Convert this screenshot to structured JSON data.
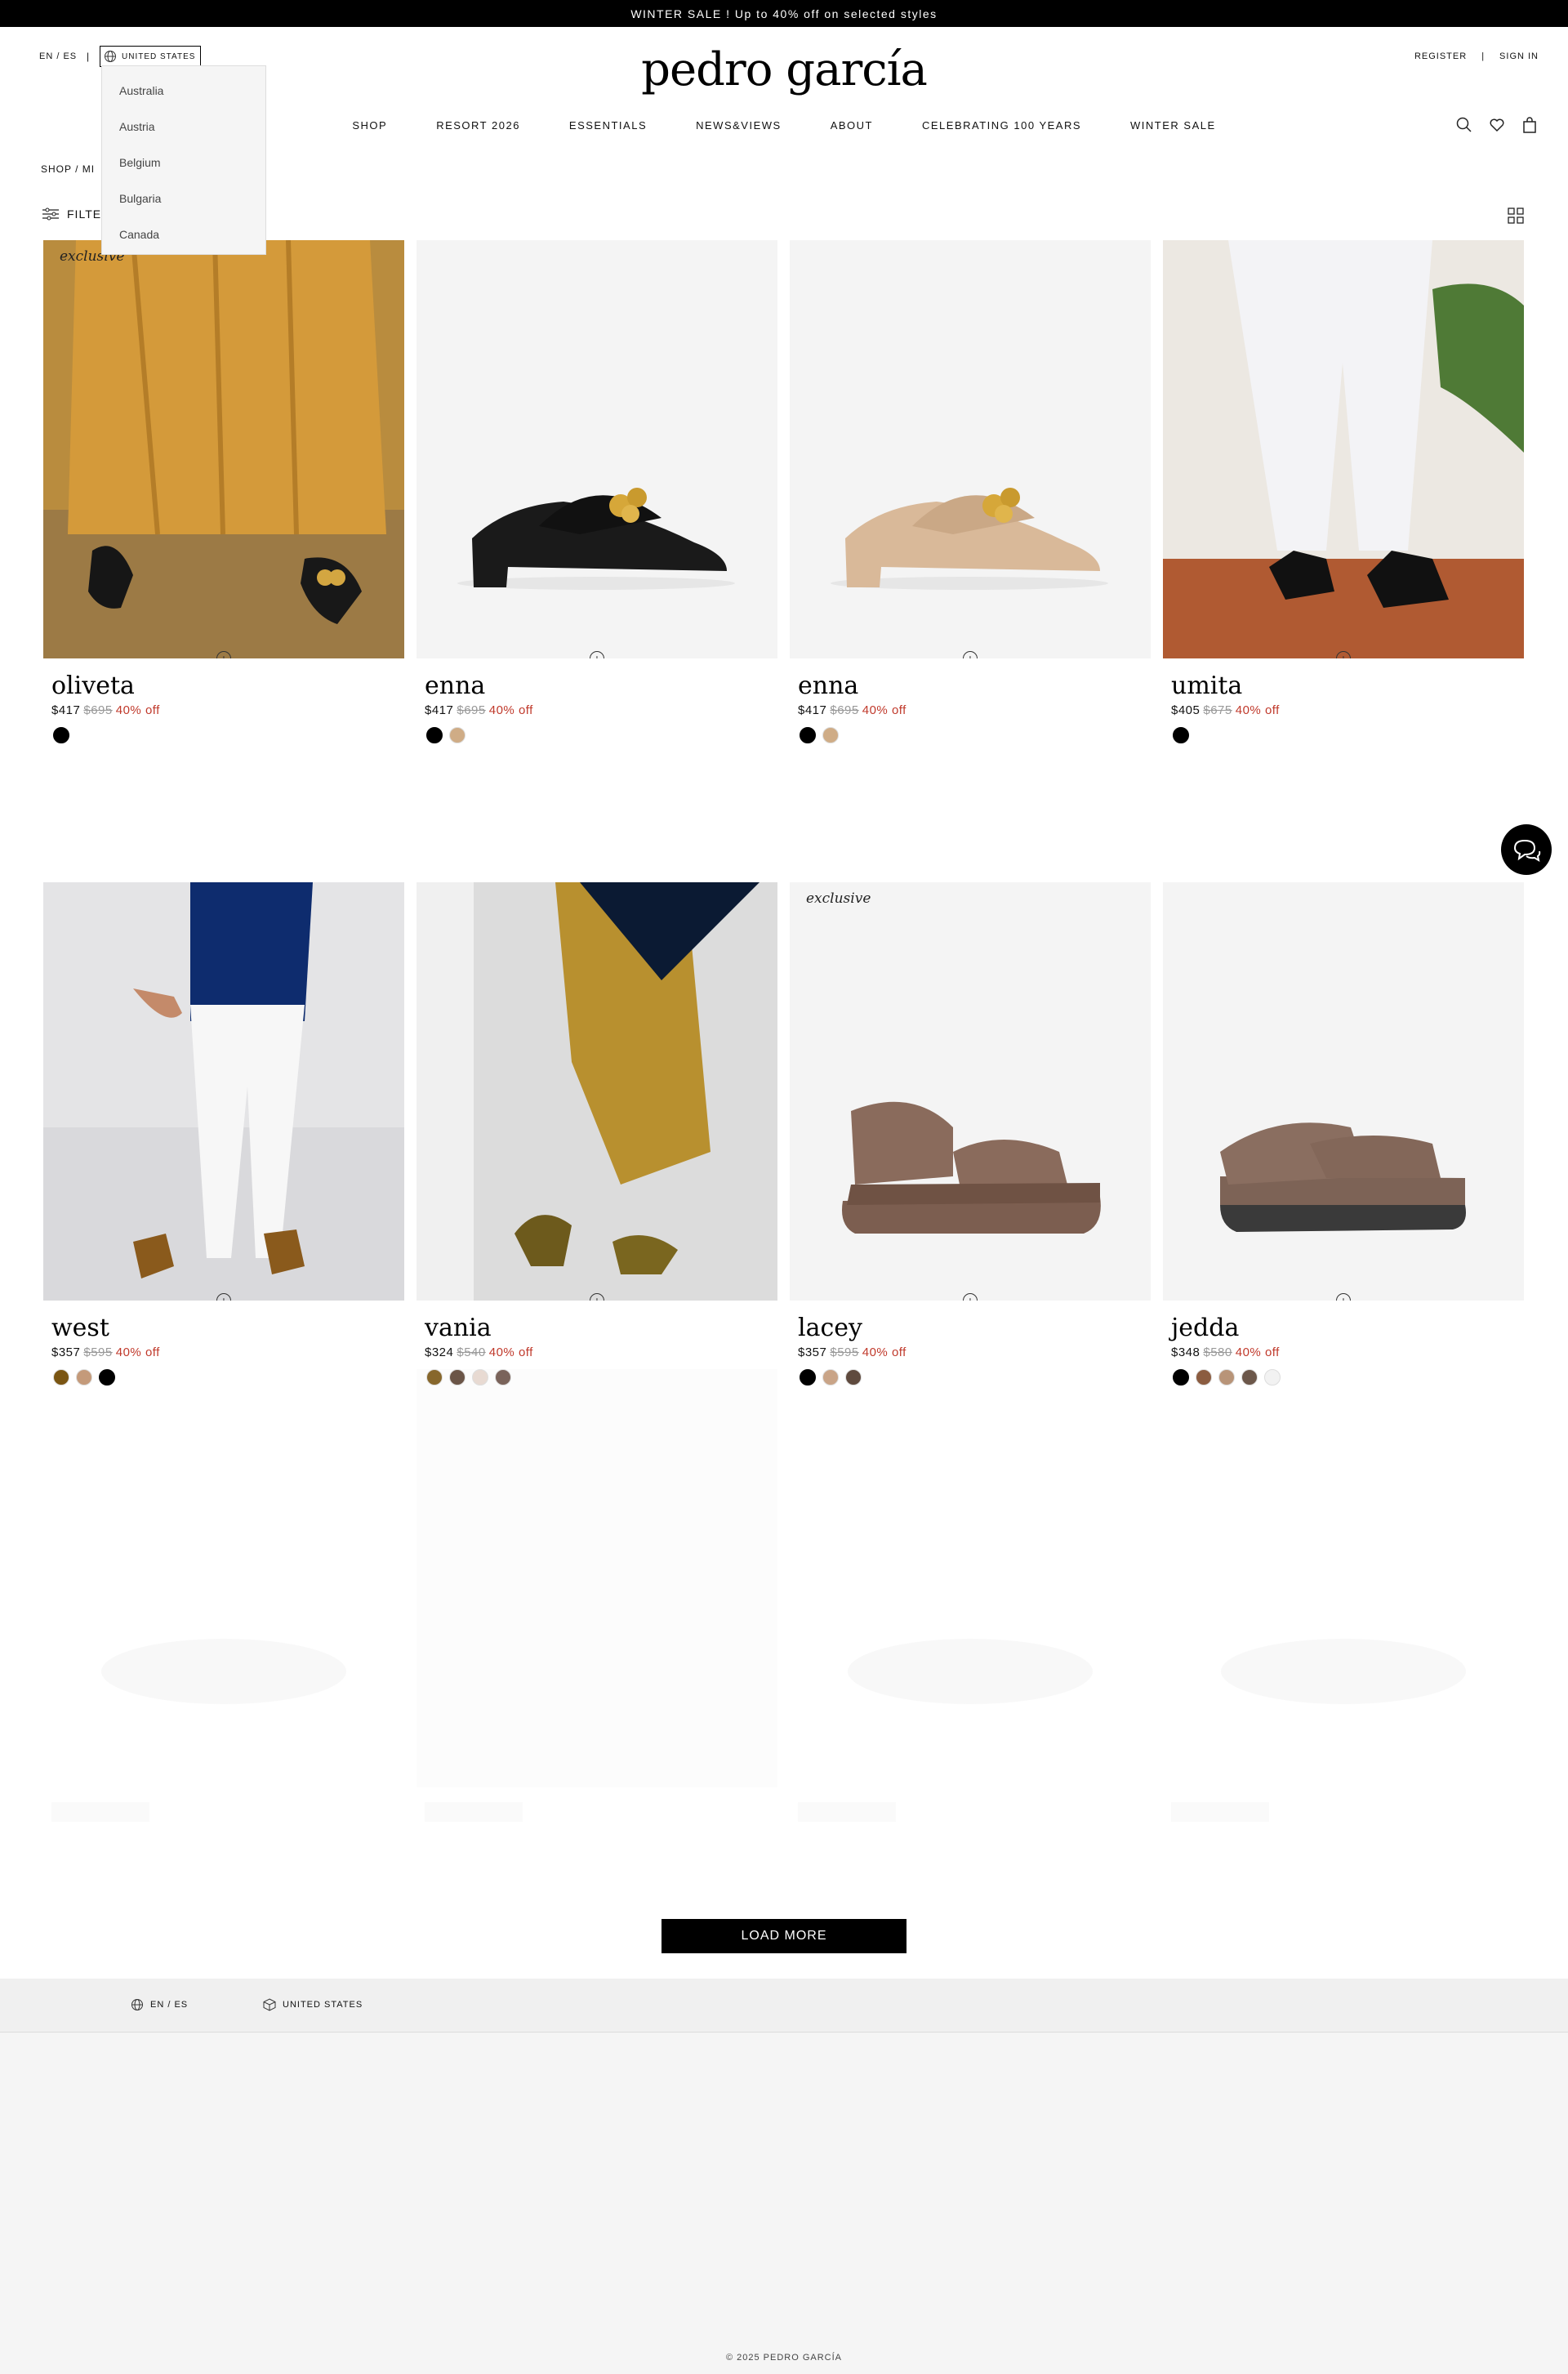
{
  "promo": {
    "text": "WINTER SALE ! Up to 40% off on selected styles"
  },
  "header": {
    "lang": "EN / ES",
    "separator": "|",
    "country": "UNITED STATES",
    "logo": "pedro garcía",
    "register": "REGISTER",
    "account_separator": "|",
    "sign_in": "SIGN IN"
  },
  "country_dropdown": {
    "options": [
      "Australia",
      "Austria",
      "Belgium",
      "Bulgaria",
      "Canada"
    ]
  },
  "nav": {
    "items": [
      "SHOP",
      "RESORT 2026",
      "ESSENTIALS",
      "NEWS&VIEWS",
      "ABOUT",
      "CELEBRATING 100 YEARS",
      "WINTER SALE"
    ]
  },
  "breadcrumb": "SHOP / MI",
  "filter": {
    "label": "FILTER"
  },
  "products": [
    {
      "name": "oliveta",
      "badge": "exclusive",
      "price": "$417",
      "original": "$695",
      "discount": "40% off",
      "swatches": [
        "#000000"
      ],
      "image": "model-orange-dress-black-sandal"
    },
    {
      "name": "enna",
      "badge": "",
      "price": "$417",
      "original": "$695",
      "discount": "40% off",
      "swatches": [
        "#000000",
        "#cfac86"
      ],
      "image": "black-chain-mule"
    },
    {
      "name": "enna",
      "badge": "",
      "price": "$417",
      "original": "$695",
      "discount": "40% off",
      "swatches": [
        "#000000",
        "#cfac86"
      ],
      "image": "beige-chain-mule"
    },
    {
      "name": "umita",
      "badge": "",
      "price": "$405",
      "original": "$675",
      "discount": "40% off",
      "swatches": [
        "#000000"
      ],
      "image": "model-white-pants-black-mule"
    },
    {
      "name": "west",
      "badge": "",
      "price": "$357",
      "original": "$595",
      "discount": "40% off",
      "swatches": [
        "#7a5512",
        "#c49a7a",
        "#000000"
      ],
      "image": "model-white-jeans-tan-sandal"
    },
    {
      "name": "vania",
      "badge": "",
      "price": "$324",
      "original": "$540",
      "discount": "40% off",
      "swatches": [
        "#7a5512",
        "#5a4130",
        "#e8d9cf",
        "#6b5146"
      ],
      "image": "model-mustard-skirt-suede-sandal"
    },
    {
      "name": "lacey",
      "badge": "exclusive",
      "price": "$357",
      "original": "$595",
      "discount": "40% off",
      "swatches": [
        "#000000",
        "#c9a487",
        "#5f4a3e"
      ],
      "image": "taupe-wedge-sandal"
    },
    {
      "name": "jedda",
      "badge": "",
      "price": "$348",
      "original": "$580",
      "discount": "40% off",
      "swatches": [
        "#000000",
        "#8b5c40",
        "#b89478",
        "#6c574a",
        "#f2f2f2"
      ],
      "image": "taupe-strap-sandal"
    }
  ],
  "load_more": "LOAD MORE",
  "footer": {
    "lang": "EN / ES",
    "country": "UNITED STATES",
    "copyright": "© 2025 PEDRO GARCÍA"
  }
}
